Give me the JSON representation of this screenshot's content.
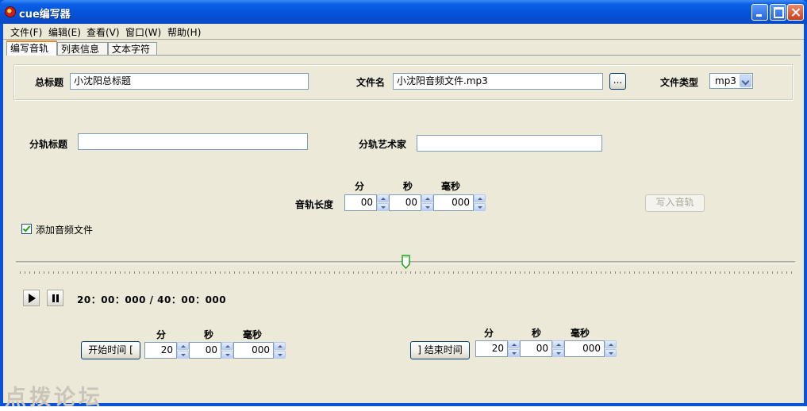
{
  "window": {
    "title": "cue编写器"
  },
  "menu": [
    "文件(F)",
    "编辑(E)",
    "查看(V)",
    "窗口(W)",
    "帮助(H)"
  ],
  "tabs": [
    "编写音轨",
    "列表信息",
    "文本字符"
  ],
  "album": {
    "title_label": "总标题",
    "title_value": "小沈阳总标题",
    "file_label": "文件名",
    "file_value": "小沈阳音频文件.mp3",
    "browse_label": "...",
    "type_label": "文件类型",
    "type_value": "mp3"
  },
  "track": {
    "title_label": "分轨标题",
    "title_value": "",
    "artist_label": "分轨艺术家",
    "artist_value": "",
    "length_label": "音轨长度",
    "unit_min": "分",
    "unit_sec": "秒",
    "unit_ms": "毫秒",
    "length_min": "00",
    "length_sec": "00",
    "length_ms": "000",
    "write_button": "写入音轨",
    "add_audio_label": "添加音频文件",
    "add_audio_checked": true
  },
  "player": {
    "timecode": "20：00：000 / 40：00：000",
    "position_fraction": 0.5
  },
  "start": {
    "button": "开始时间 [",
    "unit_min": "分",
    "unit_sec": "秒",
    "unit_ms": "毫秒",
    "min": "20",
    "sec": "00",
    "ms": "000"
  },
  "end": {
    "button": "] 结束时间",
    "unit_min": "分",
    "unit_sec": "秒",
    "unit_ms": "毫秒",
    "min": "20",
    "sec": "00",
    "ms": "000"
  },
  "watermark": "点拨论坛"
}
